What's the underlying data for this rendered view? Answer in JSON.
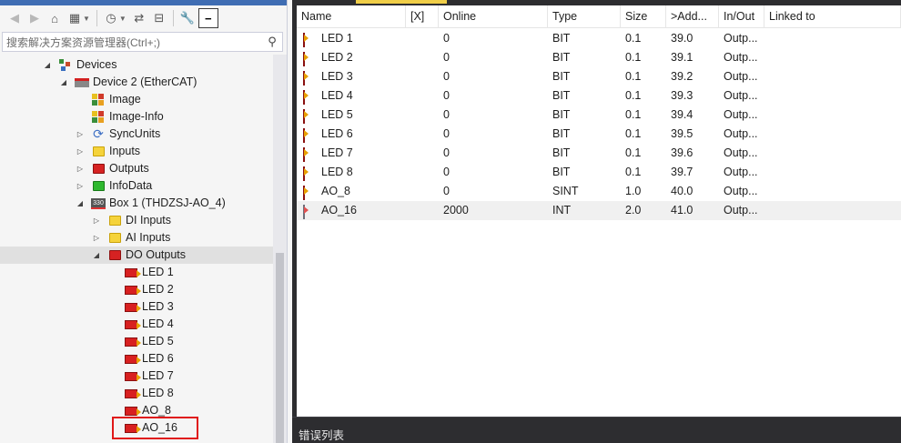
{
  "explorer": {
    "search_placeholder": "搜索解决方案资源管理器(Ctrl+;)",
    "tree": [
      {
        "label": "Devices",
        "icon": "devices-icon",
        "expander": "◢"
      },
      {
        "label": "Device 2 (EtherCAT)",
        "icon": "ethercat-device-icon",
        "expander": "◢"
      },
      {
        "label": "Image",
        "icon": "image-icon",
        "expander": ""
      },
      {
        "label": "Image-Info",
        "icon": "image-info-icon",
        "expander": ""
      },
      {
        "label": "SyncUnits",
        "icon": "sync-icon",
        "expander": "▷"
      },
      {
        "label": "Inputs",
        "icon": "folder-yellow-icon",
        "expander": "▷"
      },
      {
        "label": "Outputs",
        "icon": "folder-red-icon",
        "expander": "▷"
      },
      {
        "label": "InfoData",
        "icon": "folder-green-icon",
        "expander": "▷"
      },
      {
        "label": "Box 1 (THDZSJ-AO_4)",
        "icon": "box-icon",
        "expander": "◢"
      },
      {
        "label": "DI Inputs",
        "icon": "folder-yellow-icon",
        "expander": "▷"
      },
      {
        "label": "AI Inputs",
        "icon": "folder-yellow-icon",
        "expander": "▷"
      },
      {
        "label": "DO Outputs",
        "icon": "folder-red-icon",
        "expander": "◢"
      },
      {
        "label": "LED 1",
        "icon": "output-var-icon",
        "expander": ""
      },
      {
        "label": "LED 2",
        "icon": "output-var-icon",
        "expander": ""
      },
      {
        "label": "LED 3",
        "icon": "output-var-icon",
        "expander": ""
      },
      {
        "label": "LED 4",
        "icon": "output-var-icon",
        "expander": ""
      },
      {
        "label": "LED 5",
        "icon": "output-var-icon",
        "expander": ""
      },
      {
        "label": "LED 6",
        "icon": "output-var-icon",
        "expander": ""
      },
      {
        "label": "LED 7",
        "icon": "output-var-icon",
        "expander": ""
      },
      {
        "label": "LED 8",
        "icon": "output-var-icon",
        "expander": ""
      },
      {
        "label": "AO_8",
        "icon": "output-var-icon",
        "expander": ""
      },
      {
        "label": "AO_16",
        "icon": "output-var-icon",
        "expander": ""
      }
    ]
  },
  "table": {
    "columns": [
      "Name",
      "[X]",
      "Online",
      "Type",
      "Size",
      ">Add...",
      "In/Out",
      "Linked to"
    ],
    "rows": [
      {
        "name": "LED 1",
        "x": "",
        "online": "0",
        "type": "BIT",
        "size": "0.1",
        "addr": "39.0",
        "inout": "Outp..."
      },
      {
        "name": "LED 2",
        "x": "",
        "online": "0",
        "type": "BIT",
        "size": "0.1",
        "addr": "39.1",
        "inout": "Outp..."
      },
      {
        "name": "LED 3",
        "x": "",
        "online": "0",
        "type": "BIT",
        "size": "0.1",
        "addr": "39.2",
        "inout": "Outp..."
      },
      {
        "name": "LED 4",
        "x": "",
        "online": "0",
        "type": "BIT",
        "size": "0.1",
        "addr": "39.3",
        "inout": "Outp..."
      },
      {
        "name": "LED 5",
        "x": "",
        "online": "0",
        "type": "BIT",
        "size": "0.1",
        "addr": "39.4",
        "inout": "Outp..."
      },
      {
        "name": "LED 6",
        "x": "",
        "online": "0",
        "type": "BIT",
        "size": "0.1",
        "addr": "39.5",
        "inout": "Outp..."
      },
      {
        "name": "LED 7",
        "x": "",
        "online": "0",
        "type": "BIT",
        "size": "0.1",
        "addr": "39.6",
        "inout": "Outp..."
      },
      {
        "name": "LED 8",
        "x": "",
        "online": "0",
        "type": "BIT",
        "size": "0.1",
        "addr": "39.7",
        "inout": "Outp..."
      },
      {
        "name": "AO_8",
        "x": "",
        "online": "0",
        "type": "SINT",
        "size": "1.0",
        "addr": "40.0",
        "inout": "Outp..."
      },
      {
        "name": "AO_16",
        "x": "",
        "online": "2000",
        "type": "INT",
        "size": "2.0",
        "addr": "41.0",
        "inout": "Outp..."
      }
    ]
  },
  "error_list": {
    "label": "错误列表"
  },
  "colors": {
    "selection": "#cce8ff",
    "hover": "#e0e0e0",
    "highlight_box": "#e01818",
    "panel_dark": "#2d2d30"
  }
}
